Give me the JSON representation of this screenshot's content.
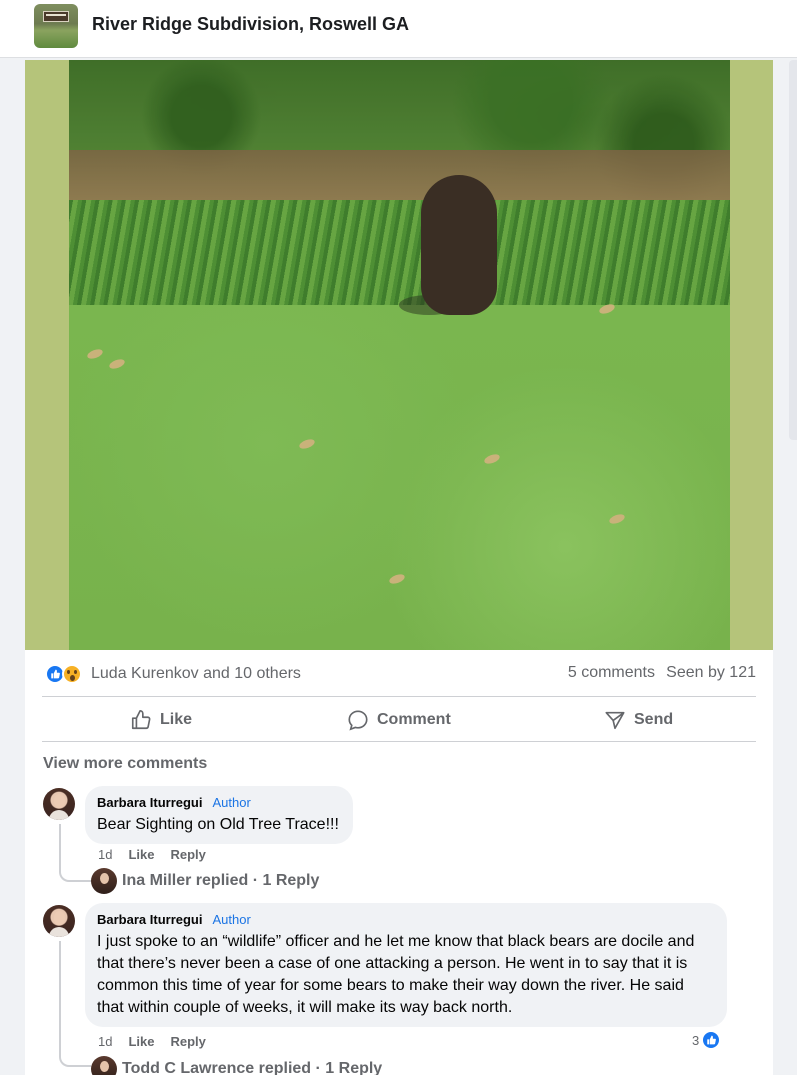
{
  "header": {
    "group_name": "River Ridge Subdivision, Roswell GA",
    "group_thumb_icon": "group-cover-thumbnail"
  },
  "post": {
    "photo_description_icon": "post-photo",
    "reactions": {
      "icons": [
        "like-icon",
        "wow-icon"
      ],
      "summary": "Luda Kurenkov and 10 others",
      "comments_count": "5 comments",
      "seen_by": "Seen by 121"
    },
    "actions": {
      "like": "Like",
      "comment": "Comment",
      "send": "Send"
    }
  },
  "comments_section": {
    "view_more": "View more comments",
    "comments": [
      {
        "author": "Barbara Iturregui",
        "badge": "Author",
        "text": "Bear Sighting on Old Tree Trace!!!",
        "time": "1d",
        "like_label": "Like",
        "reply_label": "Reply",
        "replies_summary": "Ina Miller replied · 1 Reply"
      },
      {
        "author": "Barbara Iturregui",
        "badge": "Author",
        "text": "I just spoke to an “wildlife” officer and he let me know that black bears are docile and that there’s never been a case of one attacking a person. He went in to say that it is common this time of year for some bears to make their way down the river. He said that within couple of weeks, it will make its way back north.",
        "time": "1d",
        "like_label": "Like",
        "reply_label": "Reply",
        "like_count": "3",
        "replies_summary": "Todd C Lawrence replied · 1 Reply"
      }
    ]
  },
  "colors": {
    "accent": "#1877f2",
    "muted_text": "#65676b",
    "bubble_bg": "#f0f2f5",
    "author_badge": "#1b74e4",
    "photo_frame": "#b5c47a"
  }
}
